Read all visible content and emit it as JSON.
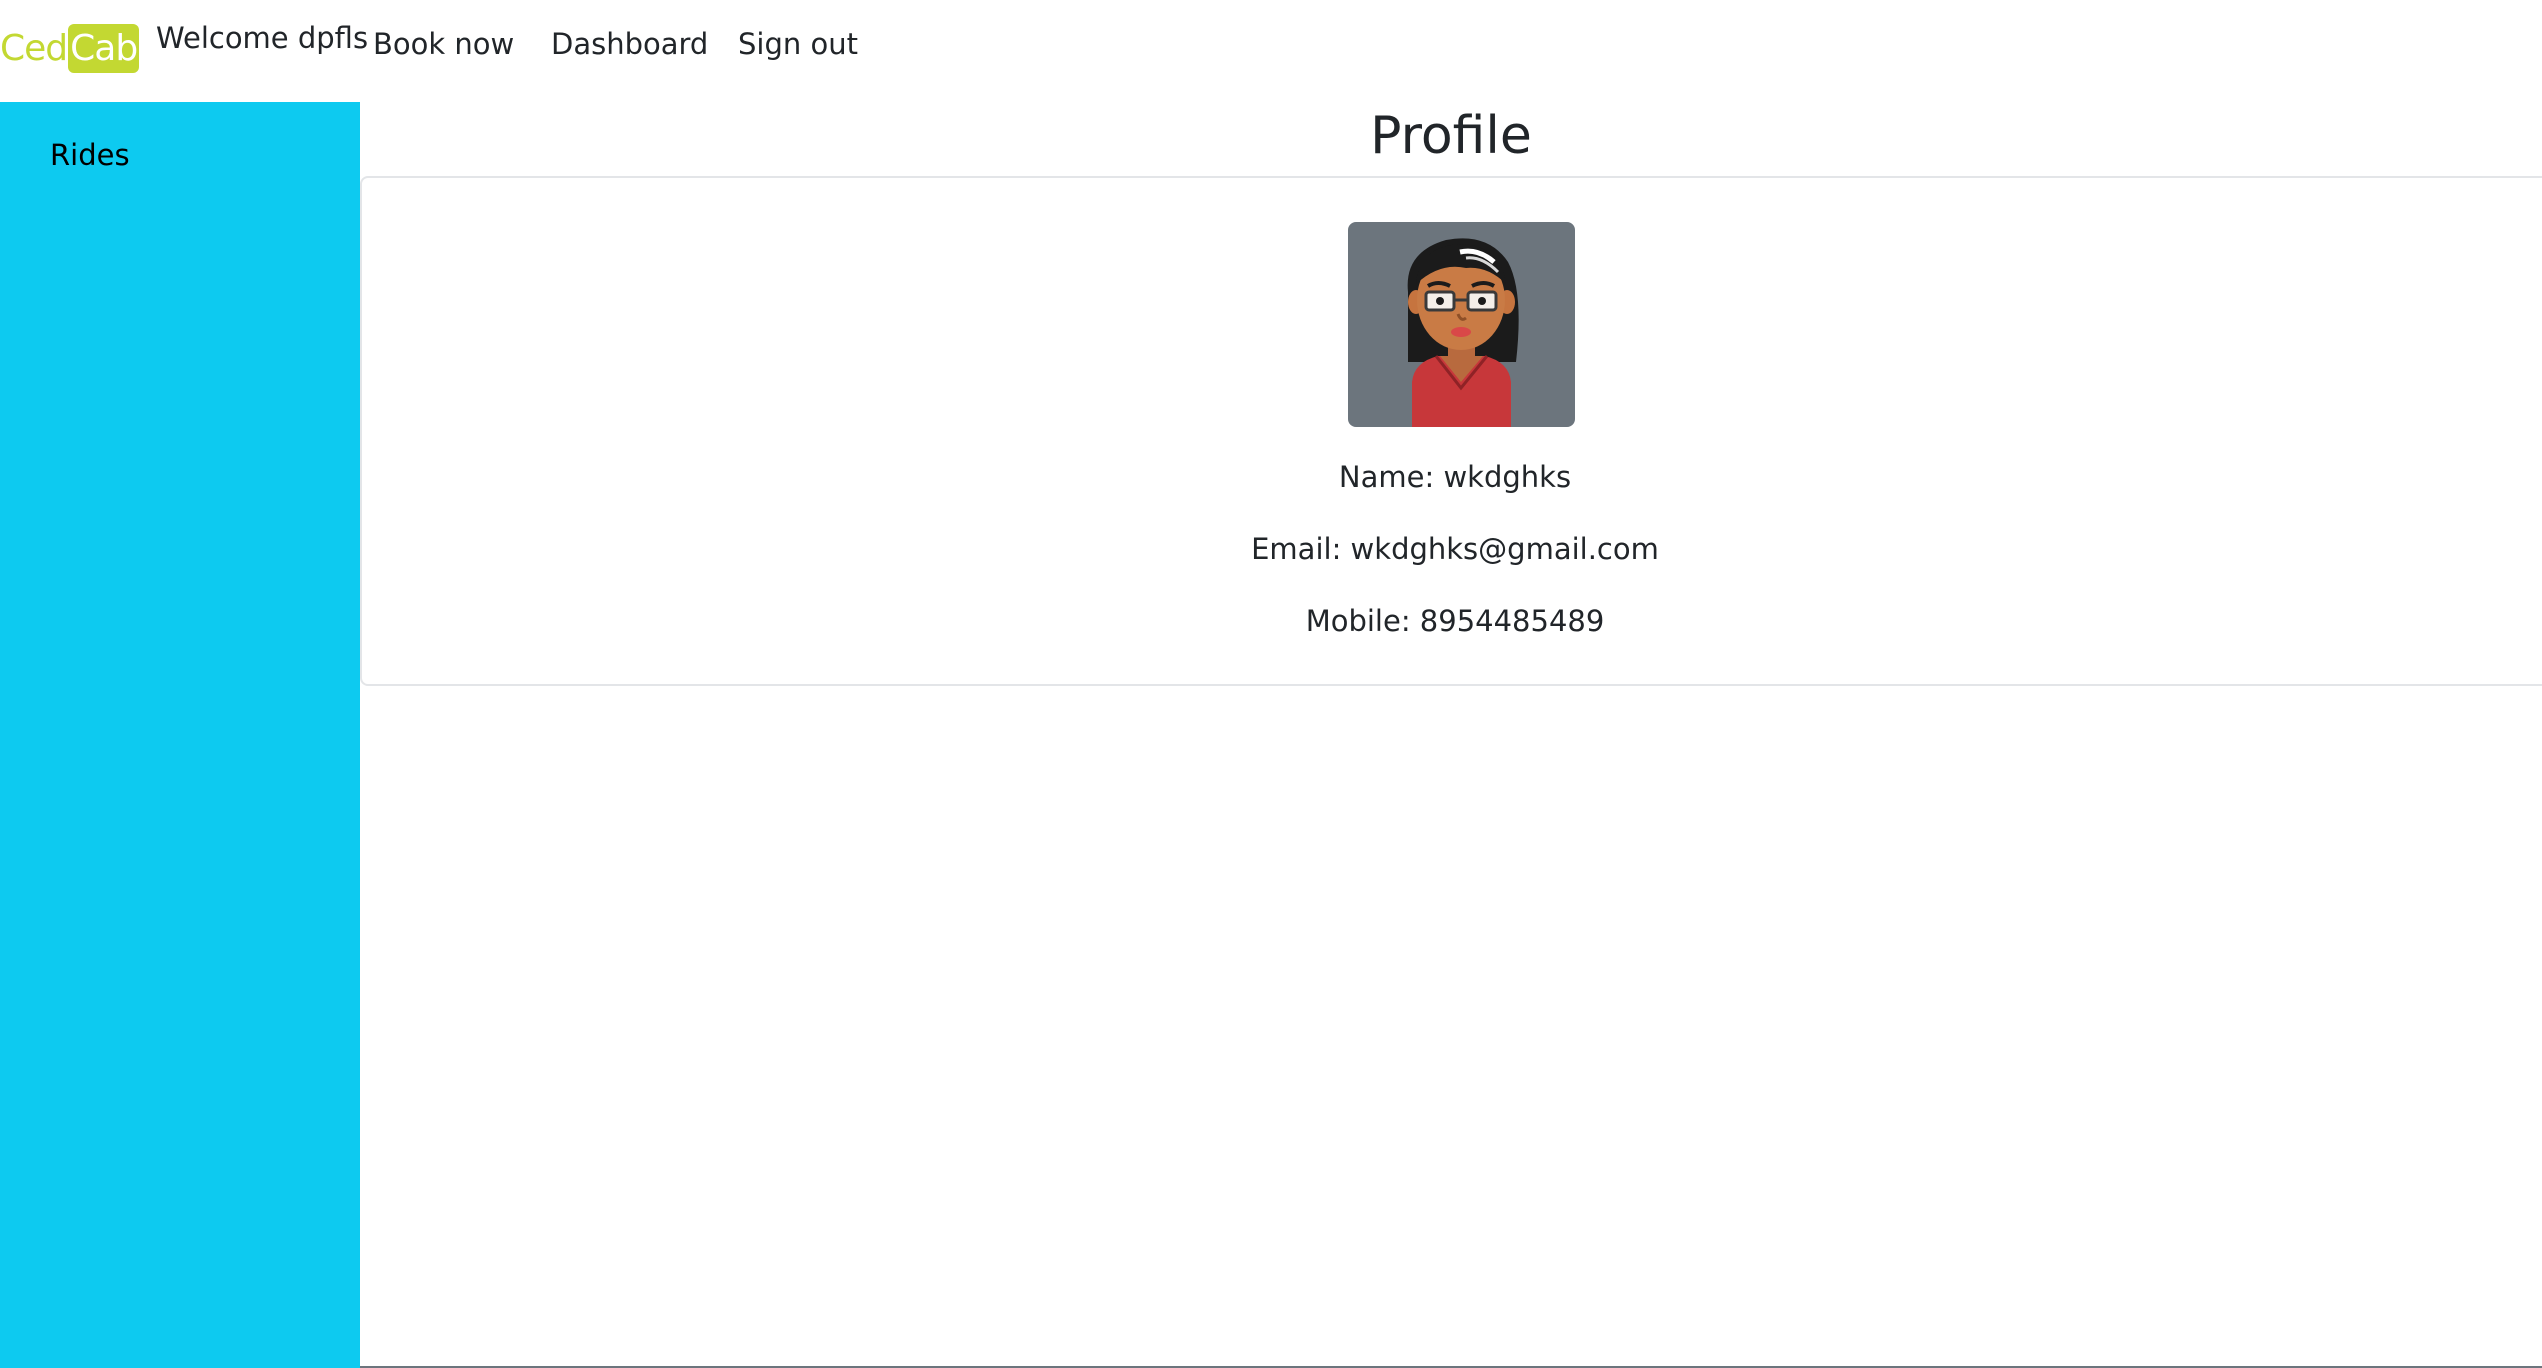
{
  "brand": {
    "part1": "Ced",
    "part2": "Cab",
    "accent_color": "#c3d832"
  },
  "nav": {
    "welcome": "Welcome dpfls",
    "links": [
      "Book now",
      "Dashboard",
      "Sign out"
    ]
  },
  "sidebar": {
    "color": "#0dcaf0",
    "items": [
      "Rides"
    ]
  },
  "page": {
    "title": "Profile"
  },
  "profile": {
    "avatar_icon": "avatar-woman-icon",
    "name": "Name: wkdghks",
    "email": "Email: wkdghks@gmail.com",
    "mobile": "Mobile: 8954485489"
  }
}
